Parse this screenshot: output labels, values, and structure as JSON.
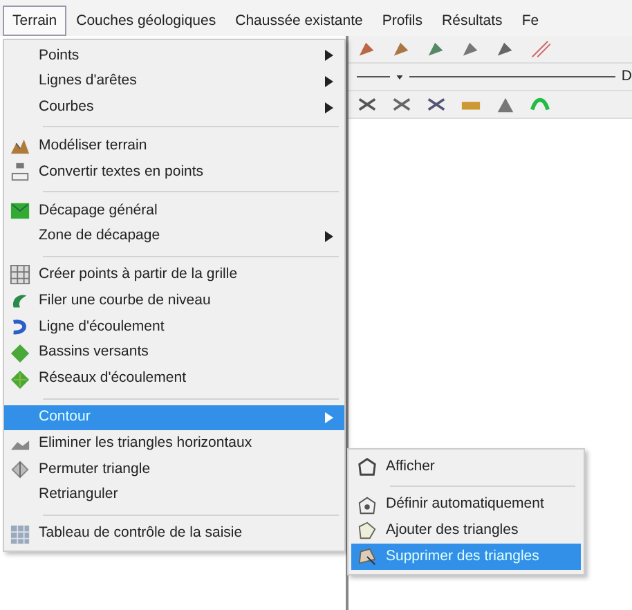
{
  "menubar": [
    {
      "label": "Terrain",
      "selected": true
    },
    {
      "label": "Couches géologiques",
      "selected": false
    },
    {
      "label": "Chaussée existante",
      "selected": false
    },
    {
      "label": "Profils",
      "selected": false
    },
    {
      "label": "Résultats",
      "selected": false
    },
    {
      "label": "Fe",
      "selected": false
    }
  ],
  "toolbar": {
    "cut_label": "D"
  },
  "menu": [
    {
      "kind": "branch",
      "label": "Points",
      "selected": false
    },
    {
      "kind": "branch",
      "label": "Lignes d'arêtes",
      "selected": false
    },
    {
      "kind": "branch",
      "label": "Courbes",
      "selected": false
    },
    {
      "kind": "separator"
    },
    {
      "kind": "item",
      "label": "Modéliser terrain",
      "selected": false
    },
    {
      "kind": "item",
      "label": "Convertir textes en points",
      "selected": false
    },
    {
      "kind": "separator"
    },
    {
      "kind": "item",
      "label": "Décapage général",
      "selected": false
    },
    {
      "kind": "branch",
      "label": "Zone de décapage",
      "selected": false
    },
    {
      "kind": "separator"
    },
    {
      "kind": "item",
      "label": "Créer points à partir de la grille",
      "selected": false
    },
    {
      "kind": "item",
      "label": "Filer une courbe de niveau",
      "selected": false
    },
    {
      "kind": "item",
      "label": "Ligne d'écoulement",
      "selected": false
    },
    {
      "kind": "item",
      "label": "Bassins versants",
      "selected": false
    },
    {
      "kind": "item",
      "label": "Réseaux d'écoulement",
      "selected": false
    },
    {
      "kind": "separator"
    },
    {
      "kind": "branch",
      "label": "Contour",
      "selected": true
    },
    {
      "kind": "item",
      "label": "Eliminer les triangles horizontaux",
      "selected": false
    },
    {
      "kind": "item",
      "label": "Permuter triangle",
      "selected": false
    },
    {
      "kind": "item",
      "label": "Retrianguler",
      "selected": false
    },
    {
      "kind": "separator"
    },
    {
      "kind": "item",
      "label": "Tableau de contrôle de la saisie",
      "selected": false
    }
  ],
  "submenu": [
    {
      "kind": "item",
      "label": "Afficher",
      "selected": false
    },
    {
      "kind": "separator"
    },
    {
      "kind": "item",
      "label": "Définir automatiquement",
      "selected": false
    },
    {
      "kind": "item",
      "label": "Ajouter des triangles",
      "selected": false
    },
    {
      "kind": "item",
      "label": "Supprimer des triangles",
      "selected": true
    }
  ]
}
